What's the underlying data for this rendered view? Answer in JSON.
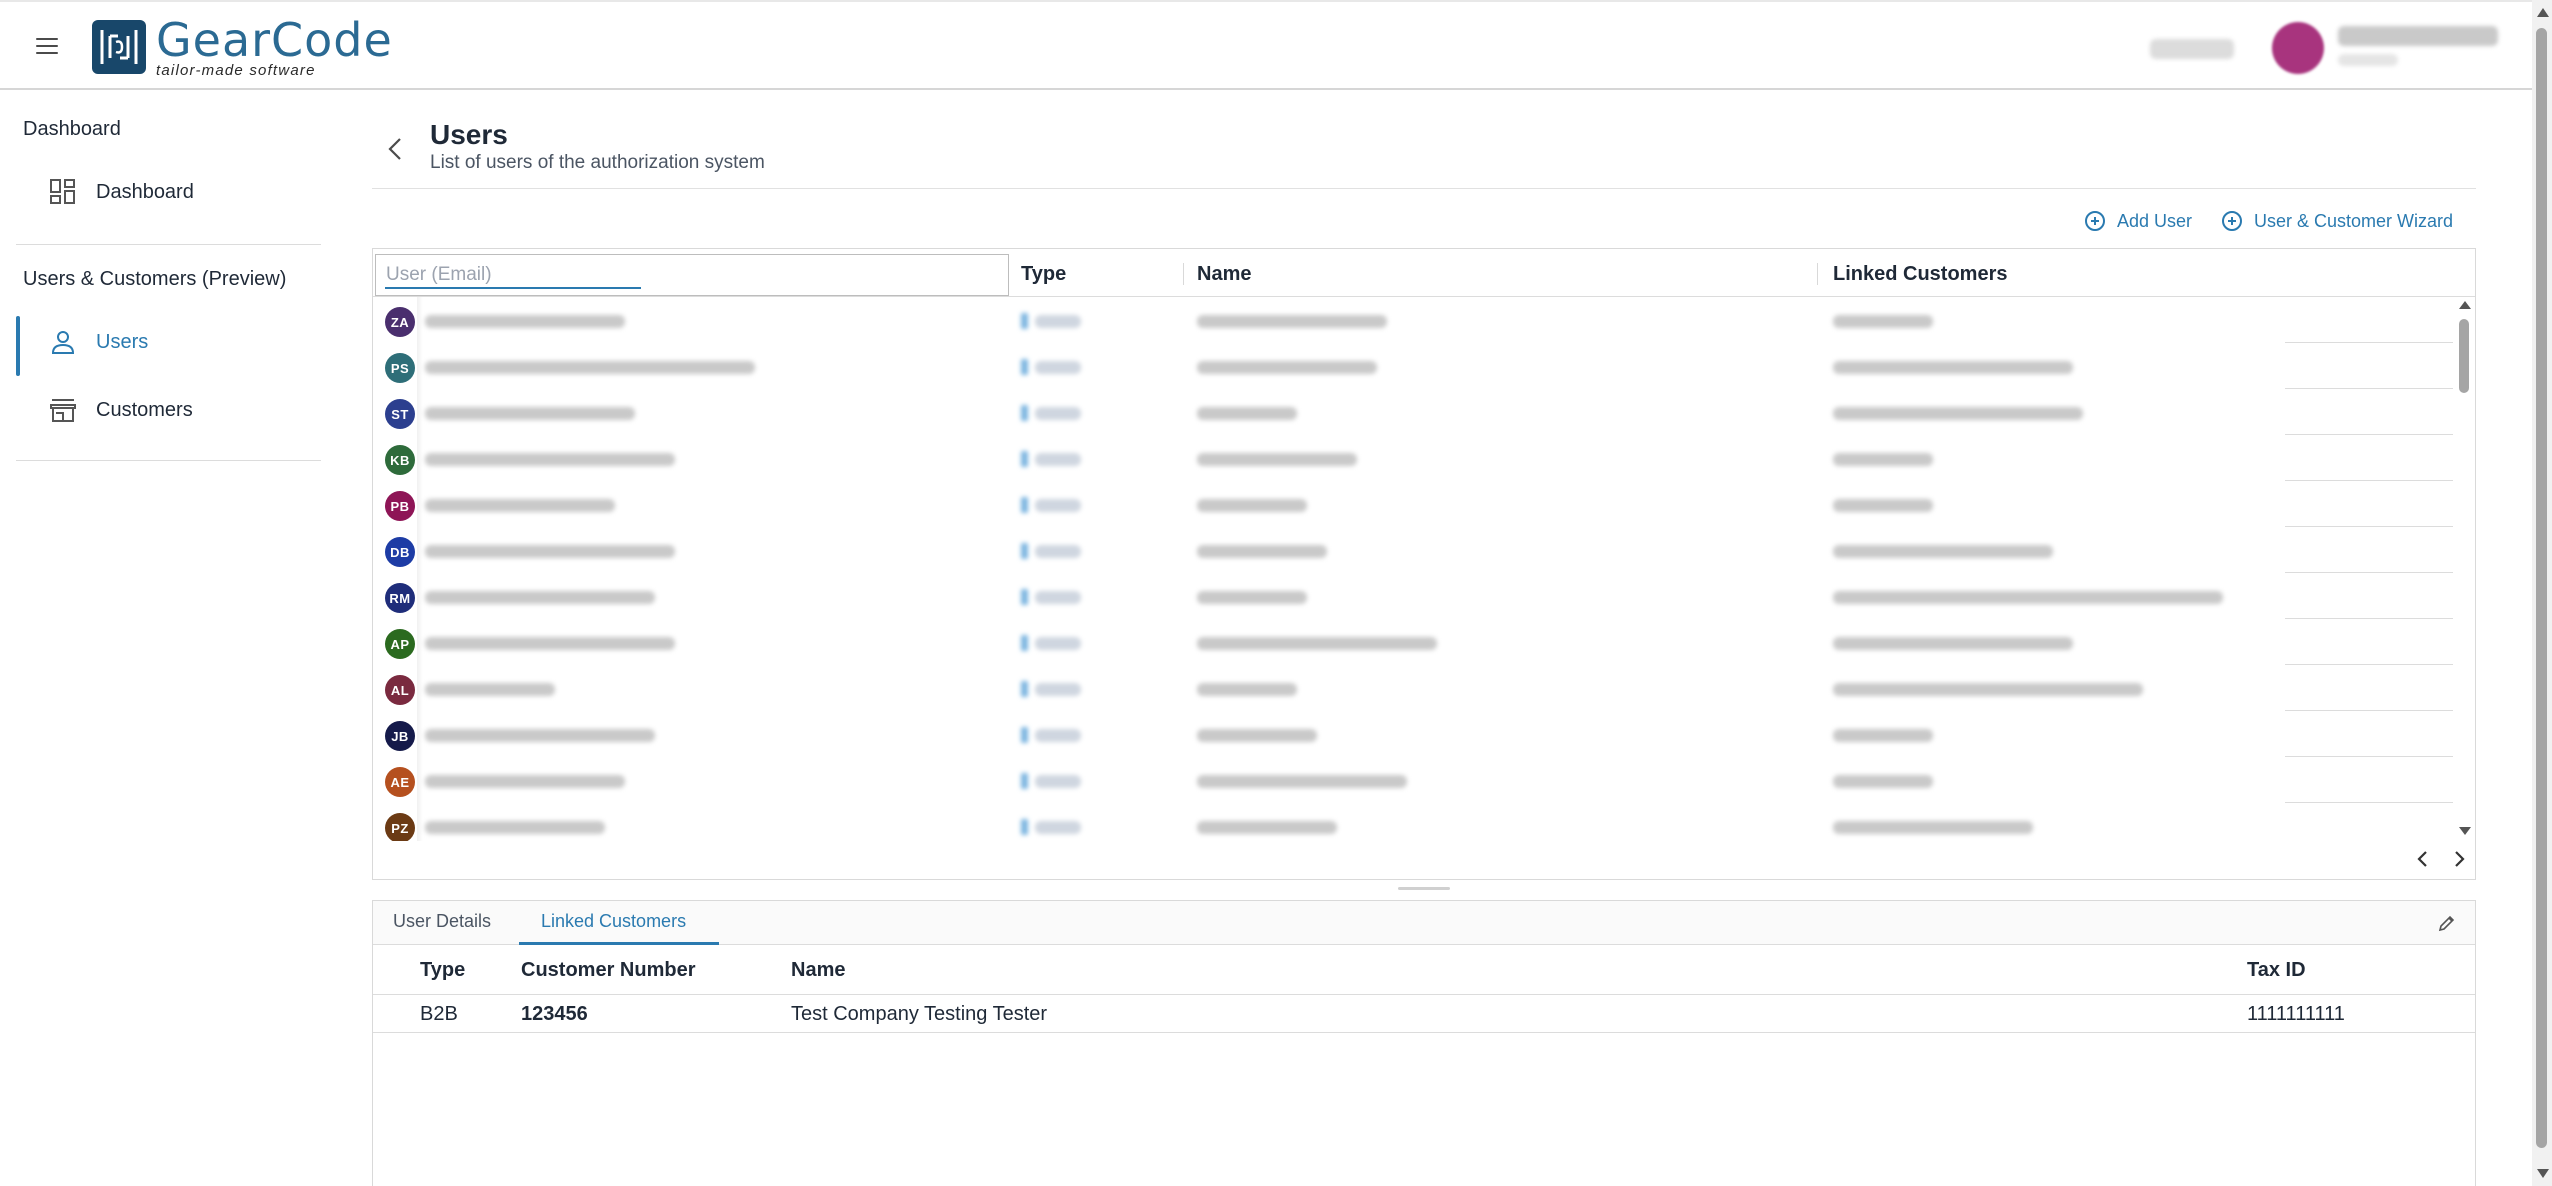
{
  "app": {
    "logo_title": "GearCode",
    "logo_subtitle": "tailor-made software",
    "brand_color": "#2a7ab0"
  },
  "sidebar": {
    "sections": [
      {
        "title": "Dashboard",
        "items": [
          {
            "label": "Dashboard",
            "icon": "dashboard-grid-icon",
            "active": false
          }
        ]
      },
      {
        "title": "Users & Customers (Preview)",
        "items": [
          {
            "label": "Users",
            "icon": "person-icon",
            "active": true
          },
          {
            "label": "Customers",
            "icon": "storefront-icon",
            "active": false
          }
        ]
      }
    ]
  },
  "page": {
    "title": "Users",
    "subtitle": "List of users of the authorization system"
  },
  "actions": {
    "add_user": "Add User",
    "wizard": "User & Customer Wizard"
  },
  "users_grid": {
    "filter_placeholder": "User (Email)",
    "columns": [
      "Type",
      "Name",
      "Linked Customers"
    ],
    "rows": [
      {
        "initials": "ZA",
        "color": "#4a2f6e"
      },
      {
        "initials": "PS",
        "color": "#2e6e78"
      },
      {
        "initials": "ST",
        "color": "#2c3f8f"
      },
      {
        "initials": "KB",
        "color": "#2e6b3b"
      },
      {
        "initials": "PB",
        "color": "#8e1556"
      },
      {
        "initials": "DB",
        "color": "#1d3ca5"
      },
      {
        "initials": "RM",
        "color": "#1f2d7a"
      },
      {
        "initials": "AP",
        "color": "#2b6a1f"
      },
      {
        "initials": "AL",
        "color": "#7a2a3f"
      },
      {
        "initials": "JB",
        "color": "#151a4a"
      },
      {
        "initials": "AE",
        "color": "#b5501f"
      },
      {
        "initials": "PZ",
        "color": "#6b3a14"
      }
    ]
  },
  "detail": {
    "tabs": [
      {
        "label": "User Details",
        "active": false
      },
      {
        "label": "Linked Customers",
        "active": true
      }
    ],
    "columns": [
      "Type",
      "Customer Number",
      "Name",
      "Tax ID"
    ],
    "rows": [
      {
        "type": "B2B",
        "customer_number": "123456",
        "name": "Test Company Testing Tester",
        "tax_id": "1111111111"
      }
    ]
  }
}
